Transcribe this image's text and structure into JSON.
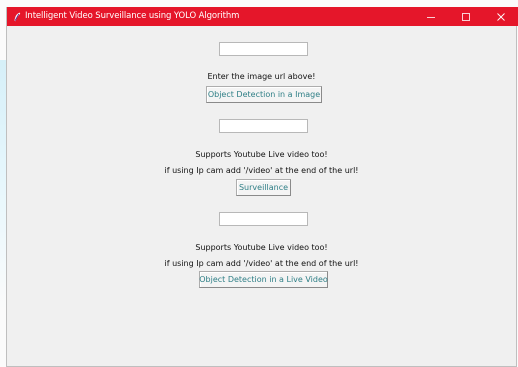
{
  "window": {
    "title": "Intelligent Video Surveillance using YOLO Algorithm",
    "titlebar_color": "#e5162a",
    "app_icon": "feather-icon",
    "controls": {
      "minimize_icon": "minimize-icon",
      "maximize_icon": "maximize-icon",
      "close_icon": "close-icon"
    }
  },
  "image_section": {
    "url_value": "",
    "label": "Enter the image url above!",
    "button_label": "Object Detection in a Image"
  },
  "surveillance_section": {
    "url_value": "",
    "label_line1": "Supports Youtube Live video too!",
    "label_line2": "if using Ip cam add '/video' at the end of the url!",
    "button_label": "Surveillance"
  },
  "live_section": {
    "url_value": "",
    "label_line1": "Supports Youtube Live video too!",
    "label_line2": "if using Ip cam add '/video' at the end of the url!",
    "button_label": "Object Detection in a Live Video"
  },
  "colors": {
    "button_text": "#2f7f86",
    "window_background": "#f0f0f0"
  }
}
